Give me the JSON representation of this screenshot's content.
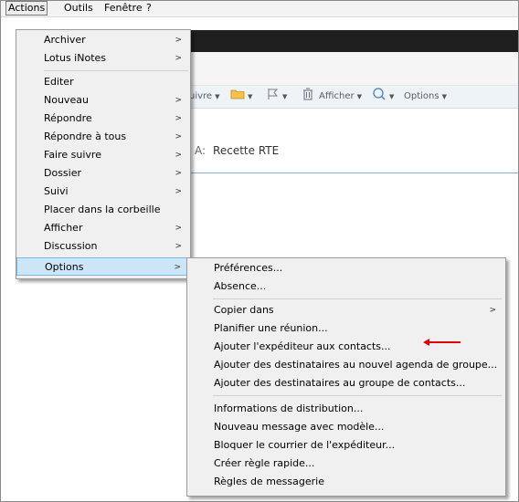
{
  "menubar": {
    "actions": "Actions",
    "outils": "Outils",
    "fenetre": "Fenêtre",
    "help": "?"
  },
  "toolbar": {
    "suivre": "uivre",
    "afficher": "Afficher",
    "options": "Options"
  },
  "recipient": {
    "label": "A:",
    "value": "Recette RTE"
  },
  "actions_menu": {
    "items": [
      {
        "label": "Archiver",
        "submenu": true
      },
      {
        "label": "Lotus iNotes",
        "submenu": true
      },
      {
        "label": "Editer",
        "submenu": false
      },
      {
        "label": "Nouveau",
        "submenu": true
      },
      {
        "label": "Répondre",
        "submenu": true
      },
      {
        "label": "Répondre à tous",
        "submenu": true
      },
      {
        "label": "Faire suivre",
        "submenu": true
      },
      {
        "label": "Dossier",
        "submenu": true
      },
      {
        "label": "Suivi",
        "submenu": true
      },
      {
        "label": "Placer dans la corbeille",
        "submenu": false
      },
      {
        "label": "Afficher",
        "submenu": true
      },
      {
        "label": "Discussion",
        "submenu": true
      },
      {
        "label": "Options",
        "submenu": true,
        "selected": true
      }
    ]
  },
  "options_menu": {
    "items": [
      {
        "label": "Préférences..."
      },
      {
        "label": "Absence..."
      },
      {
        "label": "Copier dans",
        "submenu": true
      },
      {
        "label": "Planifier une réunion..."
      },
      {
        "label": "Ajouter l'expéditeur aux contacts..."
      },
      {
        "label": "Ajouter des destinataires au nouvel agenda de groupe..."
      },
      {
        "label": "Ajouter des destinataires au groupe de contacts..."
      },
      {
        "label": "Informations de distribution..."
      },
      {
        "label": "Nouveau message avec modèle..."
      },
      {
        "label": "Bloquer le courrier de l'expéditeur..."
      },
      {
        "label": "Créer règle rapide..."
      },
      {
        "label": "Règles de messagerie"
      }
    ]
  },
  "colors": {
    "annotation_arrow": "#e00000",
    "selection": "#cde6f7",
    "dark_bar": "#1f1f1f"
  }
}
